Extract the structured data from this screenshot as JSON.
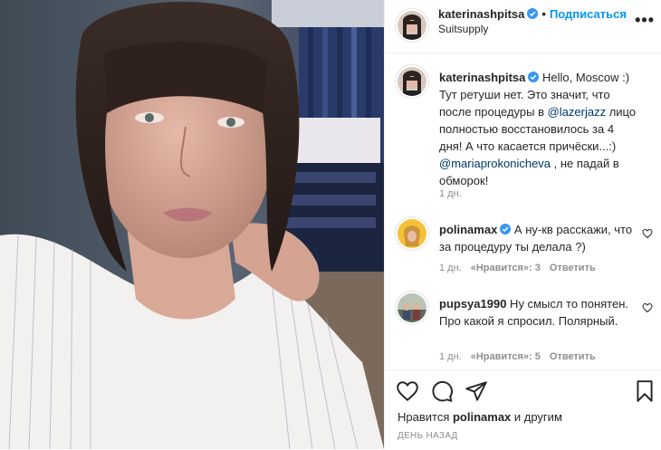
{
  "post": {
    "author": "katerinashpitsa",
    "follow_label": "Подписаться",
    "dot": "•",
    "location": "Suitsupply",
    "more_icon": "more-icon"
  },
  "caption": {
    "user": "katerinashpitsa",
    "text_1": "Hello, Moscow :) Тут ретуши нет. Это значит, что после процедуры в ",
    "mention_1": "@lazerjazz",
    "text_2": " лицо полностью восстановилось за 4 дня! А что касается причёски...:) ",
    "mention_2": "@mariaprokonicheva",
    "text_3": " , не падай в обморок!",
    "time": "1 дн."
  },
  "comments": [
    {
      "user": "polinamax",
      "text": " А ну-кв расскажи, что за процедуру ты делала ?)",
      "time": "1 дн.",
      "likes": "«Нравится»: 3",
      "reply": "Ответить"
    },
    {
      "user": "pupsya1990",
      "text": " Ну смысл то понятен. Про какой я спросил. Полярный.",
      "time": "1 дн.",
      "likes": "«Нравится»: 5",
      "reply": "Ответить"
    }
  ],
  "footer": {
    "likes_prefix": "Нравится ",
    "likes_user": "polinamax",
    "likes_suffix": " и другим",
    "time": "ДЕНЬ НАЗАД"
  },
  "colors": {
    "accent": "#0095f6",
    "mention": "#00376b",
    "verified": "#3897f0",
    "muted": "#8e8e8e"
  }
}
